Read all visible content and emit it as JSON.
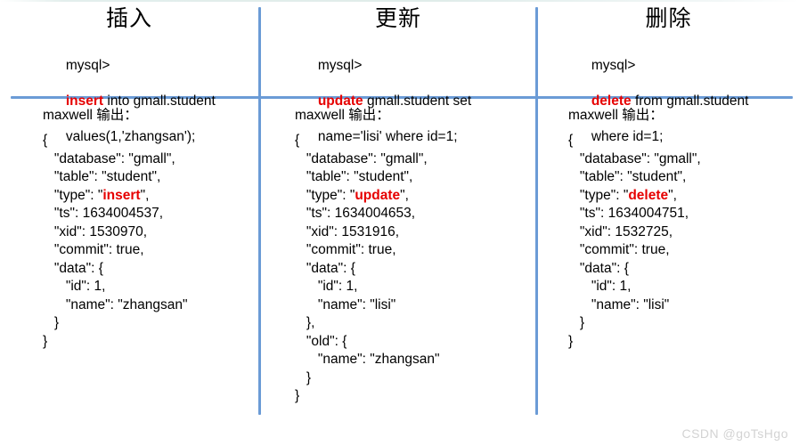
{
  "theme": {
    "divider_color": "#6b9bd6",
    "keyword_color": "#e60000",
    "text_color": "#000000",
    "background": "#ffffff",
    "watermark_color": "#d3d3d3"
  },
  "watermark": "CSDN @goTsHgo",
  "columns": [
    {
      "id": "insert",
      "title": "插入",
      "sql": {
        "prompt": "mysql>",
        "keyword": "insert",
        "rest_line2": " into gmall.student",
        "line3": "values(1,'zhangsan');"
      },
      "output_label": "maxwell 输出：",
      "json_lines": [
        "{",
        "   \"database\": \"gmall\",",
        "   \"table\": \"student\",",
        "   \"type\": \"\u0000insert\u0000\",",
        "   \"ts\": 1634004537,",
        "   \"xid\": 1530970,",
        "   \"commit\": true,",
        "   \"data\": {",
        "      \"id\": 1,",
        "      \"name\": \"zhangsan\"",
        "   }",
        "}"
      ],
      "json_keyword": "insert",
      "json_keyword_line_index": 3
    },
    {
      "id": "update",
      "title": "更新",
      "sql": {
        "prompt": "mysql>",
        "keyword": "update",
        "rest_line2": " gmall.student set",
        "line3": "name='lisi' where id=1;"
      },
      "output_label": "maxwell 输出：",
      "json_lines": [
        "{",
        "   \"database\": \"gmall\",",
        "   \"table\": \"student\",",
        "   \"type\": \"\u0000update\u0000\",",
        "   \"ts\": 1634004653,",
        "   \"xid\": 1531916,",
        "   \"commit\": true,",
        "   \"data\": {",
        "      \"id\": 1,",
        "      \"name\": \"lisi\"",
        "   },",
        "   \"old\": {",
        "      \"name\": \"zhangsan\"",
        "   }",
        "}"
      ],
      "json_keyword": "update",
      "json_keyword_line_index": 3
    },
    {
      "id": "delete",
      "title": "删除",
      "sql": {
        "prompt": "mysql>",
        "keyword": "delete",
        "rest_line2": " from gmall.student",
        "line3": "where id=1;"
      },
      "output_label": "maxwell 输出：",
      "json_lines": [
        "{",
        "   \"database\": \"gmall\",",
        "   \"table\": \"student\",",
        "   \"type\": \"\u0000delete\u0000\",",
        "   \"ts\": 1634004751,",
        "   \"xid\": 1532725,",
        "   \"commit\": true,",
        "   \"data\": {",
        "      \"id\": 1,",
        "      \"name\": \"lisi\"",
        "   }",
        "}"
      ],
      "json_keyword": "delete",
      "json_keyword_line_index": 3
    }
  ]
}
